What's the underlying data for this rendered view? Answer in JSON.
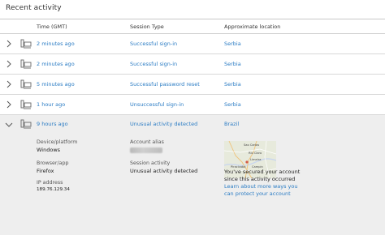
{
  "page": {
    "title": "Recent activity"
  },
  "columns": {
    "time": "Time (GMT)",
    "session": "Session Type",
    "location": "Approximate location"
  },
  "rows": [
    {
      "time": "2 minutes ago",
      "session": "Successful sign-in",
      "location": "Serbia",
      "expanded": false
    },
    {
      "time": "2 minutes ago",
      "session": "Successful sign-in",
      "location": "Serbia",
      "expanded": false
    },
    {
      "time": "5 minutes ago",
      "session": "Successful password reset",
      "location": "Serbia",
      "expanded": false
    },
    {
      "time": "1 hour ago",
      "session": "Unsuccessful sign-in",
      "location": "Serbia",
      "expanded": false
    },
    {
      "time": "9 hours ago",
      "session": "Unusual activity detected",
      "location": "Brazil",
      "expanded": true
    }
  ],
  "detail": {
    "device_label": "Device/platform",
    "device_value": "Windows",
    "browser_label": "Browser/app",
    "browser_value": "Firefox",
    "ip_label": "IP address",
    "ip_value": "189.76.129.34",
    "alias_label": "Account alias",
    "session_label": "Session activity",
    "session_value": "Unusual activity detected",
    "map_labels": {
      "city1": "Sao Carlos",
      "city2": "Rio Claro",
      "city3": "Limeira",
      "city4": "Piracicaba",
      "city5": "Campin"
    },
    "secured_line1": "You've secured your account",
    "secured_line2": "since this activity occurred",
    "learn_line1": "Learn about more ways you",
    "learn_line2": "can protect your account"
  },
  "icons": {
    "collapsed": "chevron-right-icon",
    "expanded": "chevron-down-icon",
    "device": "computer-icon"
  },
  "colors": {
    "link": "#2b7cc4",
    "expanded_bg": "#eeeeee",
    "divider": "#d8d8d8"
  }
}
